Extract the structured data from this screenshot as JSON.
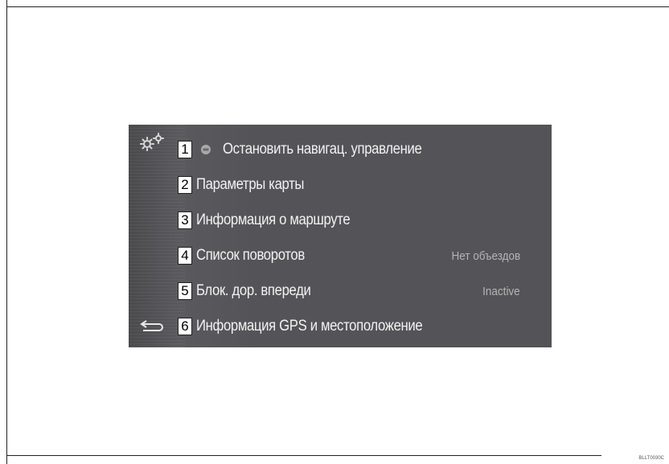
{
  "menu": {
    "items": [
      {
        "number": "1",
        "label": "Остановить навигац. управление",
        "value": "",
        "icon": "navigation-stop-icon"
      },
      {
        "number": "2",
        "label": "Параметры карты",
        "value": ""
      },
      {
        "number": "3",
        "label": "Информация о маршруте",
        "value": ""
      },
      {
        "number": "4",
        "label": "Список поворотов",
        "value": "Нет объездов"
      },
      {
        "number": "5",
        "label": "Блок. дор. впереди",
        "value": "Inactive"
      },
      {
        "number": "6",
        "label": "Информация GPS и местоположение",
        "value": ""
      }
    ]
  },
  "icons": {
    "settings": "gears-icon",
    "back": "back-arrow-icon"
  },
  "colors": {
    "screen_background": "#545458",
    "label_text": "#f2f2f2",
    "value_text": "#b4b4b4"
  },
  "figure_code": "BLLT0030C"
}
